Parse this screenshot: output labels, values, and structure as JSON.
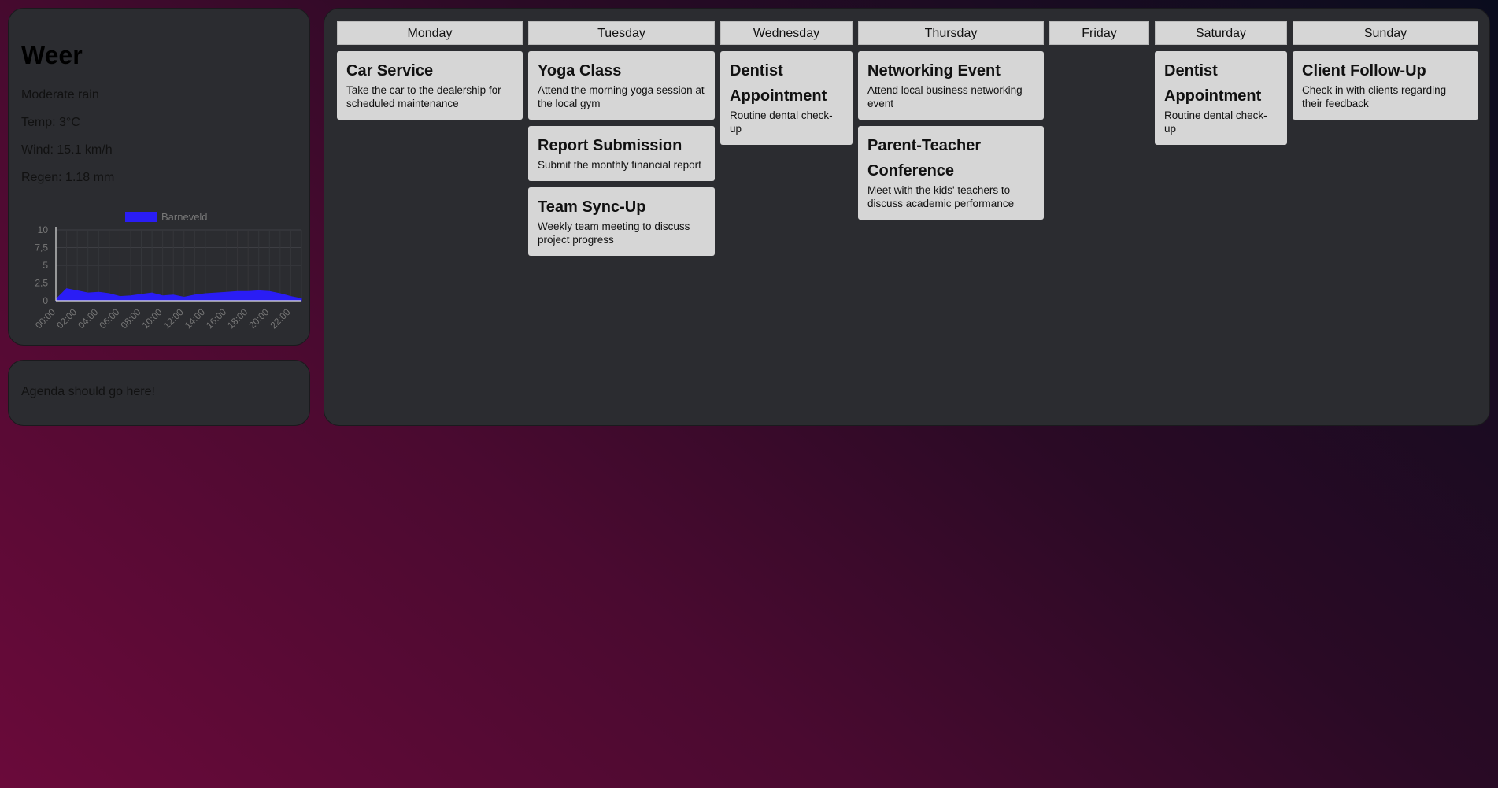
{
  "weather": {
    "title": "Weer",
    "condition": "Moderate rain",
    "temp": "Temp: 3°C",
    "wind": "Wind: 15.1 km/h",
    "rain": "Regen: 1.18 mm"
  },
  "chart_data": {
    "type": "area",
    "title": "",
    "xlabel": "",
    "ylabel": "",
    "legend": [
      "Barneveld"
    ],
    "legend_position": "top",
    "ylim": [
      0,
      10
    ],
    "y_ticks": [
      "0",
      "2,5",
      "5",
      "7,5",
      "10"
    ],
    "x_tick_labels": [
      "00:00",
      "02:00",
      "04:00",
      "06:00",
      "08:00",
      "10:00",
      "12:00",
      "14:00",
      "16:00",
      "18:00",
      "20:00",
      "22:00"
    ],
    "categories": [
      "00:00",
      "01:00",
      "02:00",
      "03:00",
      "04:00",
      "05:00",
      "06:00",
      "07:00",
      "08:00",
      "09:00",
      "10:00",
      "11:00",
      "12:00",
      "13:00",
      "14:00",
      "15:00",
      "16:00",
      "17:00",
      "18:00",
      "19:00",
      "20:00",
      "21:00",
      "22:00",
      "23:00"
    ],
    "series": [
      {
        "name": "Barneveld",
        "color": "#2a1df5",
        "values": [
          0.2,
          1.7,
          1.4,
          1.1,
          1.2,
          1.0,
          0.6,
          0.7,
          0.9,
          1.1,
          0.7,
          0.8,
          0.5,
          0.8,
          1.0,
          1.1,
          1.2,
          1.3,
          1.3,
          1.4,
          1.3,
          1.0,
          0.6,
          0.3
        ]
      }
    ],
    "grid": true
  },
  "agenda": {
    "text": "Agenda should go here!"
  },
  "week": {
    "days": [
      {
        "name": "Monday",
        "events": [
          {
            "title": "Car Service",
            "desc": "Take the car to the dealership for scheduled maintenance"
          }
        ]
      },
      {
        "name": "Tuesday",
        "events": [
          {
            "title": "Yoga Class",
            "desc": "Attend the morning yoga session at the local gym"
          },
          {
            "title": "Report Submission",
            "desc": "Submit the monthly financial report"
          },
          {
            "title": "Team Sync-Up",
            "desc": "Weekly team meeting to discuss project progress"
          }
        ]
      },
      {
        "name": "Wednesday",
        "events": [
          {
            "title": "Dentist Appointment",
            "desc": "Routine dental check-up"
          }
        ]
      },
      {
        "name": "Thursday",
        "events": [
          {
            "title": "Networking Event",
            "desc": "Attend local business networking event"
          },
          {
            "title": "Parent-Teacher Conference",
            "desc": "Meet with the kids' teachers to discuss academic performance"
          }
        ]
      },
      {
        "name": "Friday",
        "events": []
      },
      {
        "name": "Saturday",
        "events": [
          {
            "title": "Dentist Appointment",
            "desc": "Routine dental check-up"
          }
        ]
      },
      {
        "name": "Sunday",
        "events": [
          {
            "title": "Client Follow-Up",
            "desc": "Check in with clients regarding their feedback"
          }
        ]
      }
    ]
  }
}
